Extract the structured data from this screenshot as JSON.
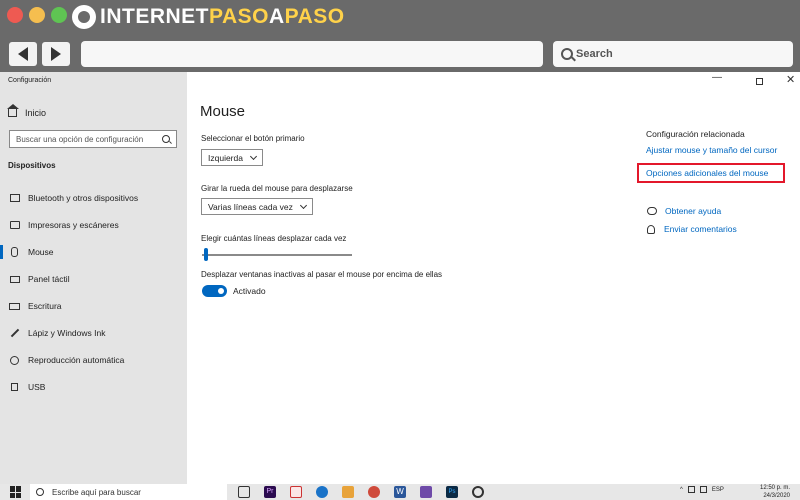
{
  "browser": {
    "brand_prefix": "INTERNET",
    "brand_accent": "PASO",
    "brand_mid": "A",
    "brand_suffix": "PASO",
    "search_label": "Search"
  },
  "sidebar": {
    "window_title": "Configuración",
    "home": "Inicio",
    "search_placeholder": "Buscar una opción de configuración",
    "section": "Dispositivos",
    "items": [
      {
        "label": "Bluetooth y otros dispositivos",
        "icon": "bluetooth-icon"
      },
      {
        "label": "Impresoras y escáneres",
        "icon": "printer-icon"
      },
      {
        "label": "Mouse",
        "icon": "mouse-icon",
        "active": true
      },
      {
        "label": "Panel táctil",
        "icon": "touchpad-icon"
      },
      {
        "label": "Escritura",
        "icon": "keyboard-icon"
      },
      {
        "label": "Lápiz y Windows Ink",
        "icon": "pen-icon"
      },
      {
        "label": "Reproducción automática",
        "icon": "autoplay-icon"
      },
      {
        "label": "USB",
        "icon": "usb-icon"
      }
    ]
  },
  "main": {
    "title": "Mouse",
    "primary_button": {
      "label": "Seleccionar el botón primario",
      "value": "Izquierda"
    },
    "scroll_wheel": {
      "label": "Girar la rueda del mouse para desplazarse",
      "value": "Varias líneas cada vez"
    },
    "lines_slider": {
      "label": "Elegir cuántas líneas desplazar cada vez",
      "fraction": 0.02
    },
    "inactive_scroll": {
      "label": "Desplazar ventanas inactivas al pasar el mouse por encima de ellas",
      "state": "Activado",
      "on": true
    },
    "related": {
      "title": "Configuración relacionada",
      "link_size": "Ajustar mouse y tamaño del cursor",
      "link_additional": "Opciones adicionales del mouse",
      "help": "Obtener ayuda",
      "feedback": "Enviar comentarios"
    },
    "window_controls": {
      "minimize": "—",
      "close": "✕"
    }
  },
  "taskbar": {
    "search_placeholder": "Escribe aquí para buscar",
    "app_badges": {
      "premiere": "Pr",
      "word": "W",
      "photoshop": "Ps"
    },
    "language": "ESP",
    "time": "12:50 p. m.",
    "date": "24/3/2020"
  },
  "colors": {
    "accent": "#0067c0",
    "highlight_box": "#e3182b",
    "sidebar_bg": "#e4e4e4",
    "chrome_bg": "#6a6a6a"
  }
}
